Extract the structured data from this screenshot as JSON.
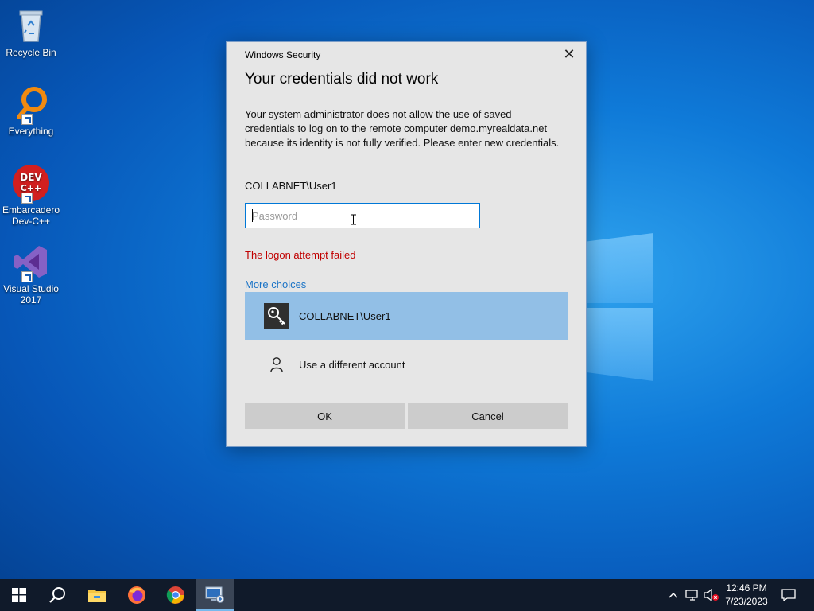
{
  "desktop": {
    "icons": [
      {
        "label": "Recycle Bin",
        "icon": "recycle-bin-icon"
      },
      {
        "label": "Everything",
        "icon": "everything-search-icon"
      },
      {
        "label": "Embarcadero\nDev-C++",
        "icon": "dev-cpp-icon"
      },
      {
        "label": "Visual Studio\n2017",
        "icon": "visual-studio-icon"
      }
    ]
  },
  "dialog": {
    "window_title": "Windows Security",
    "heading": "Your credentials did not work",
    "message": "Your system administrator does not allow the use of saved credentials to log on to the remote computer demo.myrealdata.net because its identity is not fully verified. Please enter new credentials.",
    "username": "COLLABNET\\User1",
    "password_placeholder": "Password",
    "password_value": "",
    "error": "The logon attempt failed",
    "more_choices": "More choices",
    "choices": [
      {
        "label": "COLLABNET\\User1",
        "icon": "key-icon",
        "selected": true
      },
      {
        "label": "Use a different account",
        "icon": "person-icon",
        "selected": false
      }
    ],
    "ok_label": "OK",
    "cancel_label": "Cancel"
  },
  "taskbar": {
    "apps": [
      "start-icon",
      "search-icon",
      "file-explorer-icon",
      "firefox-icon",
      "chrome-icon",
      "remote-desktop-icon"
    ],
    "active_app": "remote-desktop-icon",
    "time": "12:46 PM",
    "date": "7/23/2023"
  },
  "colors": {
    "accent": "#0078d7",
    "error": "#c00000",
    "link": "#1a73c6",
    "selected_choice": "#92bfe6",
    "taskbar": "#101a2a"
  }
}
